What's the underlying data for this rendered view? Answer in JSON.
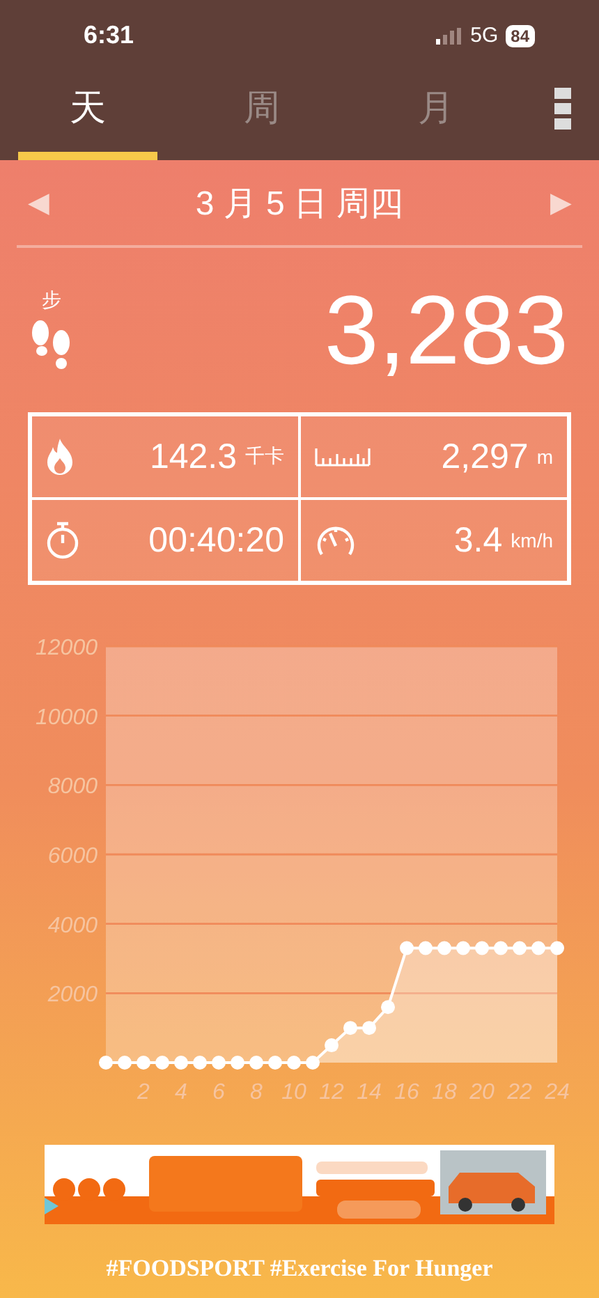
{
  "status_bar": {
    "time": "6:31",
    "network": "5G",
    "battery": "84"
  },
  "tabs": [
    {
      "label": "天",
      "selected": true
    },
    {
      "label": "周",
      "selected": false
    },
    {
      "label": "月",
      "selected": false
    }
  ],
  "date_nav": {
    "prev": "◀",
    "date": "3 月 5 日 周四",
    "next": "▶"
  },
  "steps": {
    "label": "步",
    "value": "3,283"
  },
  "stats": [
    {
      "kind": "calories",
      "value": "142.3",
      "unit": "千卡"
    },
    {
      "kind": "distance",
      "value": "2,297",
      "unit": "m"
    },
    {
      "kind": "duration",
      "value": "00:40:20"
    },
    {
      "kind": "speed",
      "value": "3.4",
      "unit": "km/h"
    }
  ],
  "chart": {
    "chart_data": {
      "type": "area",
      "x": [
        0,
        1,
        2,
        3,
        4,
        5,
        6,
        7,
        8,
        9,
        10,
        11,
        12,
        13,
        14,
        15,
        16,
        17,
        18,
        19,
        20,
        21,
        22,
        23,
        24
      ],
      "series": [
        {
          "color": "#ffffff",
          "values": [
            0,
            0,
            0,
            0,
            0,
            0,
            0,
            0,
            0,
            0,
            0,
            0,
            500,
            1000,
            1000,
            1600,
            3300,
            3300,
            3300,
            3300,
            3300,
            3300,
            3300,
            3300,
            3300
          ]
        }
      ],
      "xlim": [
        0,
        24
      ],
      "ylim": [
        0,
        12000
      ],
      "xticks": [
        2,
        4,
        6,
        8,
        10,
        12,
        14,
        16,
        18,
        20,
        22,
        24
      ],
      "yticks": [
        2000,
        4000,
        6000,
        8000,
        10000,
        12000
      ],
      "grid": true
    }
  },
  "footer": "#FOODSPORT #Exercise For Hunger"
}
